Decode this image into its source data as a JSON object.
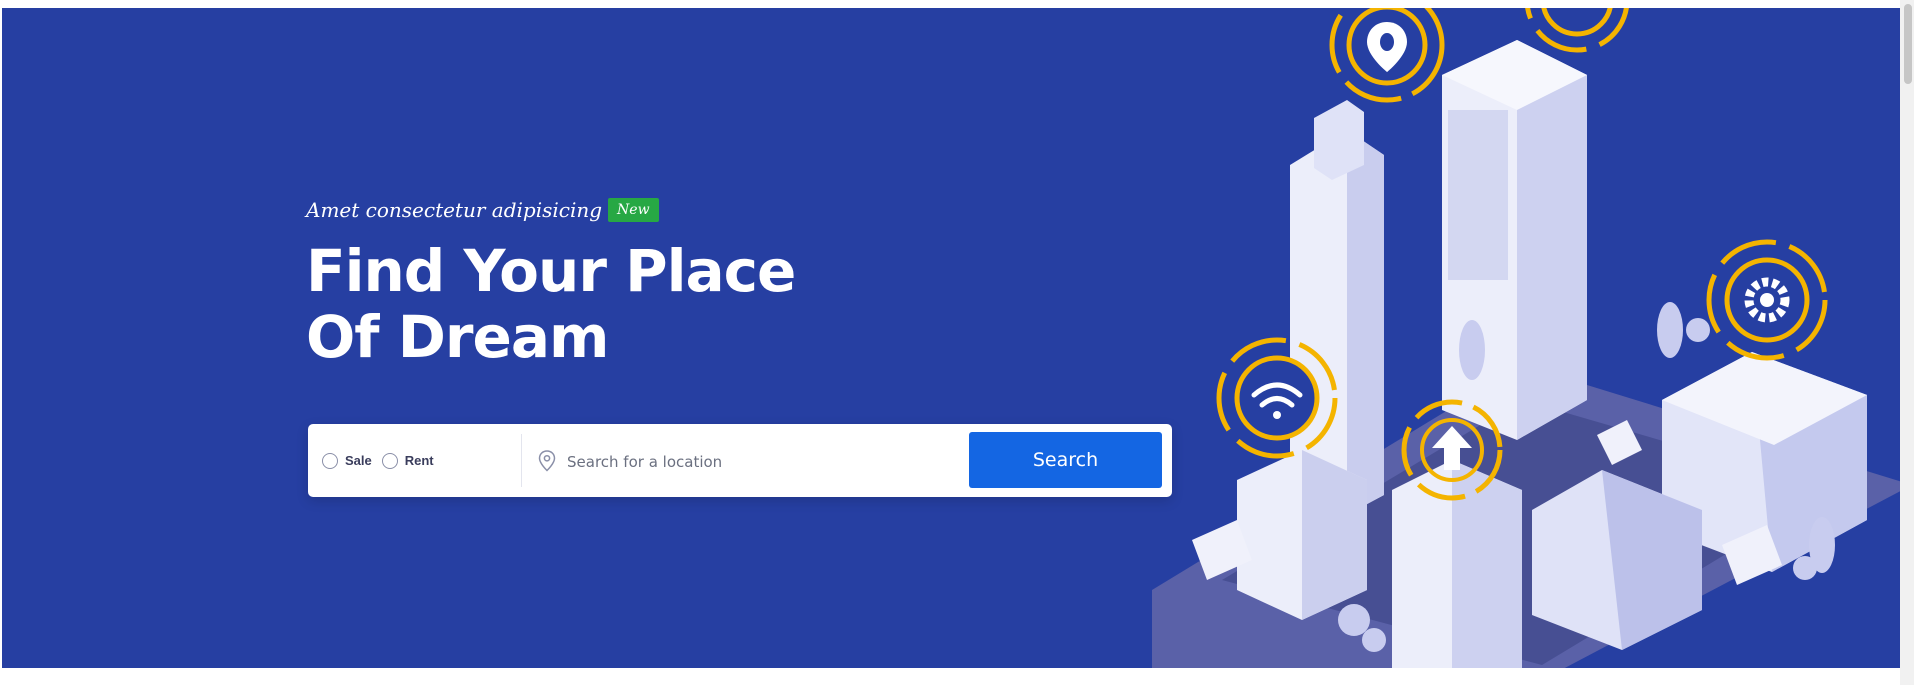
{
  "hero": {
    "tagline": "Amet consectetur adipisicing",
    "badge": "New",
    "headline_line1": "Find Your Place",
    "headline_line2": "Of Dream"
  },
  "search": {
    "options": [
      {
        "label": "Sale"
      },
      {
        "label": "Rent"
      }
    ],
    "placeholder": "Search for a location",
    "button_label": "Search"
  },
  "illustration": {
    "icons": [
      "location-pin-icon",
      "wifi-icon",
      "gear-icon",
      "upload-arrow-icon"
    ]
  },
  "colors": {
    "hero_background": "#263fa2",
    "accent_ring": "#f4b400",
    "badge": "#27a844",
    "button": "#1466e3"
  }
}
